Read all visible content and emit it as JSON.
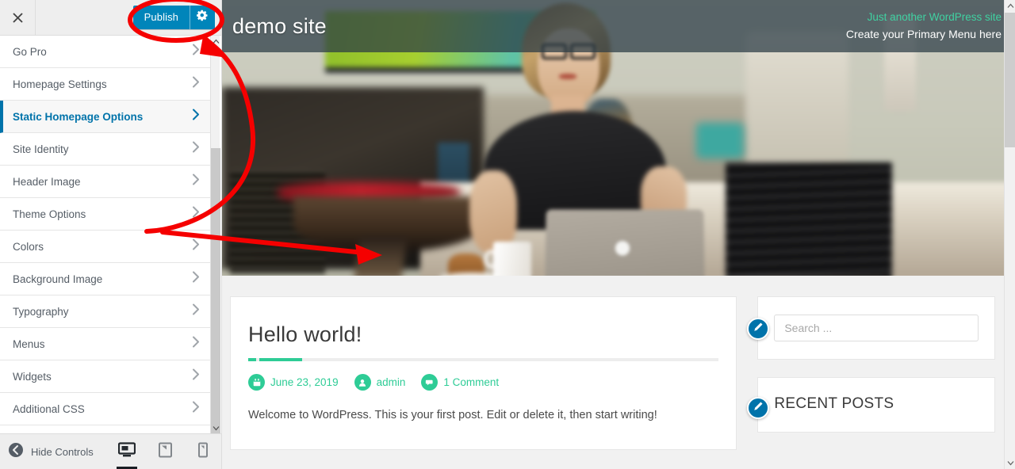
{
  "customizer": {
    "close_label": "Close",
    "publish_label": "Publish",
    "settings_label": "Publish settings",
    "panels": [
      {
        "label": "Go Pro",
        "active": false
      },
      {
        "label": "Homepage Settings",
        "active": false
      },
      {
        "label": "Static Homepage Options",
        "active": true
      },
      {
        "label": "Site Identity",
        "active": false
      },
      {
        "label": "Header Image",
        "active": false
      },
      {
        "label": "Theme Options",
        "active": false
      },
      {
        "label": "Colors",
        "active": false
      },
      {
        "label": "Background Image",
        "active": false
      },
      {
        "label": "Typography",
        "active": false
      },
      {
        "label": "Menus",
        "active": false
      },
      {
        "label": "Widgets",
        "active": false
      },
      {
        "label": "Additional CSS",
        "active": false
      }
    ],
    "footer": {
      "hide_controls_label": "Hide Controls",
      "devices": [
        {
          "name": "desktop",
          "active": true
        },
        {
          "name": "tablet",
          "active": false
        },
        {
          "name": "mobile",
          "active": false
        }
      ]
    },
    "accent_blue": "#0073aa",
    "publish_blue": "#0085ba"
  },
  "preview": {
    "site_title": "demo site",
    "site_description": "Just another WordPress site",
    "menu_hint": "Create your Primary Menu here",
    "post": {
      "title": "Hello world!",
      "date": "June 23, 2019",
      "author": "admin",
      "comments": "1 Comment",
      "excerpt": "Welcome to WordPress. This is your first post. Edit or delete it, then start writing!"
    },
    "widgets": {
      "search_placeholder": "Search ...",
      "recent_posts_title": "RECENT POSTS",
      "edit_label": "Edit"
    },
    "accent_green": "#2ecc96",
    "header_overlay": "#293a44"
  },
  "annotations": {
    "highlight_color": "#f50000",
    "ellipse_target": "publish-button",
    "curved_arrow_target": "publish-button",
    "straight_arrow_target": "preview-header-image"
  }
}
